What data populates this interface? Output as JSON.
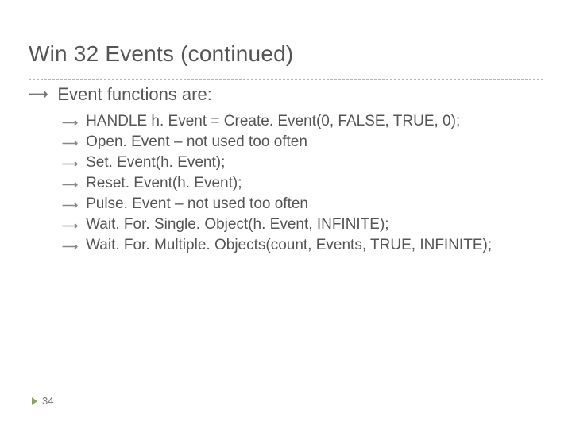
{
  "title": "Win 32 Events (continued)",
  "lvl1_text": "Event functions are:",
  "bullets": [
    "HANDLE h. Event = Create. Event(0, FALSE, TRUE, 0);",
    "Open. Event – not used too often",
    "Set. Event(h. Event);",
    "Reset. Event(h. Event);",
    "Pulse. Event – not used too often",
    "Wait. For. Single. Object(h. Event, INFINITE);",
    "Wait. For. Multiple. Objects(count, Events, TRUE, INFINITE);"
  ],
  "page_number": "34"
}
